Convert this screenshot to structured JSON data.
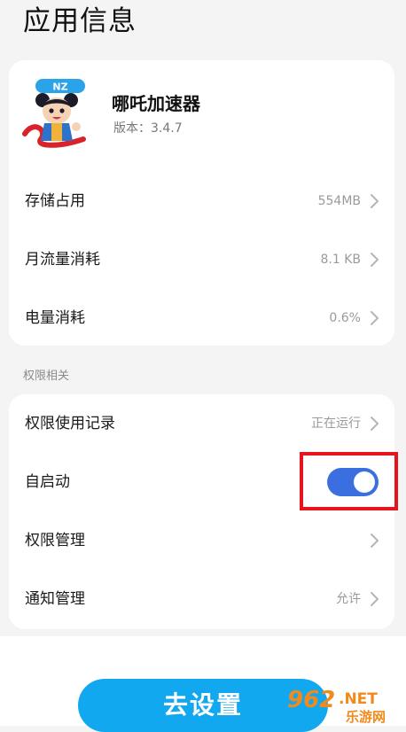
{
  "page": {
    "title": "应用信息"
  },
  "app": {
    "name": "哪吒加速器",
    "version": "版本：3.4.7",
    "icon_badge_text": "NZ"
  },
  "usage_rows": [
    {
      "label": "存储占用",
      "value": "554MB"
    },
    {
      "label": "月流量消耗",
      "value": "8.1 KB"
    },
    {
      "label": "电量消耗",
      "value": "0.6%"
    }
  ],
  "permissions": {
    "section_title": "权限相关",
    "usage_record": {
      "label": "权限使用记录",
      "value": "正在运行"
    },
    "auto_start": {
      "label": "自启动",
      "enabled": true
    },
    "permission_management": {
      "label": "权限管理"
    },
    "notification_management": {
      "label": "通知管理",
      "value": "允许"
    }
  },
  "action_button": {
    "label": "去设置"
  },
  "watermark": {
    "number_text": "962",
    "suffix": ".NET",
    "caption": "乐游网"
  },
  "colors": {
    "toggle_on": "#3b6fe0",
    "highlight": "#e8141b",
    "button_blue": "#12a8f0",
    "watermark_orange": "#f28a1b"
  }
}
